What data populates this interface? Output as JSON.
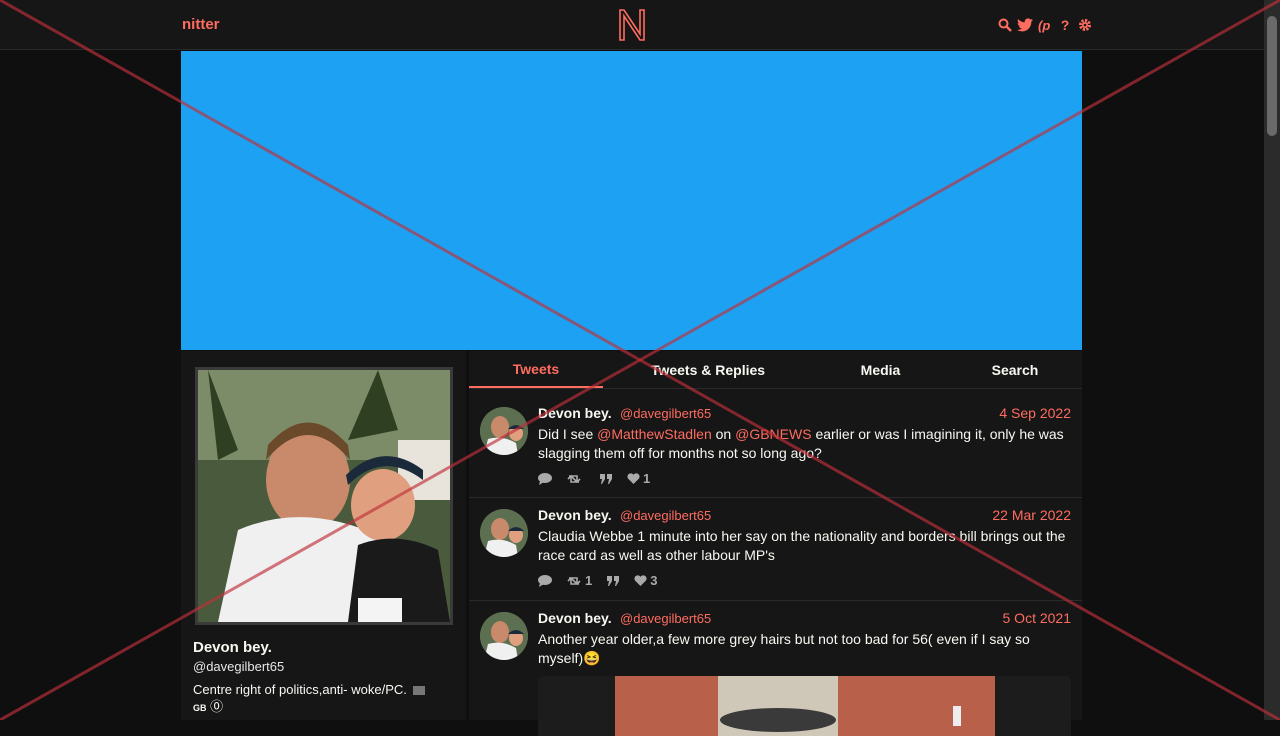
{
  "navbar": {
    "brand": "nitter",
    "icons": [
      "search-icon",
      "twitter-bird-icon",
      "rss-icon",
      "help-icon",
      "gear-icon"
    ],
    "help_glyph": "?"
  },
  "profile": {
    "fullname": "Devon bey.",
    "username": "@davegilbert65",
    "bio_text": "Centre right of politics,anti- woke/PC.",
    "bio_flag_text": "GB",
    "bio_tail": "⓪"
  },
  "tabs": [
    {
      "label": "Tweets",
      "active": true
    },
    {
      "label": "Tweets & Replies",
      "active": false
    },
    {
      "label": "Media",
      "active": false
    },
    {
      "label": "Search",
      "active": false
    }
  ],
  "tweets": [
    {
      "name": "Devon bey.",
      "handle": "@davegilbert65",
      "date": "4 Sep 2022",
      "body_parts": [
        "Did I see ",
        "@MatthewStadlen",
        " on ",
        "@GBNEWS",
        " earlier or was I imagining it, only he was slagging them off for months not so long ago?"
      ],
      "retweets": "",
      "likes": "1"
    },
    {
      "name": "Devon bey.",
      "handle": "@davegilbert65",
      "date": "22 Mar 2022",
      "body": "Claudia Webbe 1 minute into her say on the nationality and borders bill brings out the race card as well as other labour MP's",
      "retweets": "1",
      "likes": "3"
    },
    {
      "name": "Devon bey.",
      "handle": "@davegilbert65",
      "date": "5 Oct 2021",
      "body": "Another year older,a few more grey hairs but not too bad for 56( even if I say so myself)😆"
    }
  ],
  "colors": {
    "accent": "#ff6c60",
    "banner": "#1da1f2",
    "background": "#0f0f0f",
    "panel": "#161616"
  }
}
